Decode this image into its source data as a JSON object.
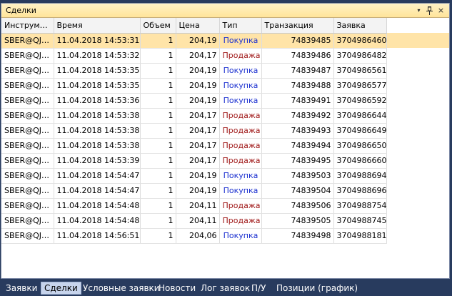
{
  "window": {
    "title": "Сделки",
    "dropdown_icon": "▾",
    "pin_icon": "pushpin-icon",
    "close_icon": "×"
  },
  "columns": [
    "Инструм…",
    "Время",
    "Объем",
    "Цена",
    "Тип",
    "Транзакция",
    "Заявка"
  ],
  "rows": [
    {
      "instrument": "SBER@QJ…",
      "time": "11.04.2018 14:53:31",
      "volume": "1",
      "price": "204,19",
      "type": "Покупка",
      "side": "buy",
      "transaction": "74839485",
      "order": "3704986460"
    },
    {
      "instrument": "SBER@QJ…",
      "time": "11.04.2018 14:53:32",
      "volume": "1",
      "price": "204,17",
      "type": "Продажа",
      "side": "sell",
      "transaction": "74839486",
      "order": "3704986482"
    },
    {
      "instrument": "SBER@QJ…",
      "time": "11.04.2018 14:53:35",
      "volume": "1",
      "price": "204,19",
      "type": "Покупка",
      "side": "buy",
      "transaction": "74839487",
      "order": "3704986561"
    },
    {
      "instrument": "SBER@QJ…",
      "time": "11.04.2018 14:53:35",
      "volume": "1",
      "price": "204,19",
      "type": "Покупка",
      "side": "buy",
      "transaction": "74839488",
      "order": "3704986577"
    },
    {
      "instrument": "SBER@QJ…",
      "time": "11.04.2018 14:53:36",
      "volume": "1",
      "price": "204,19",
      "type": "Покупка",
      "side": "buy",
      "transaction": "74839491",
      "order": "3704986592"
    },
    {
      "instrument": "SBER@QJ…",
      "time": "11.04.2018 14:53:38",
      "volume": "1",
      "price": "204,17",
      "type": "Продажа",
      "side": "sell",
      "transaction": "74839492",
      "order": "3704986644"
    },
    {
      "instrument": "SBER@QJ…",
      "time": "11.04.2018 14:53:38",
      "volume": "1",
      "price": "204,17",
      "type": "Продажа",
      "side": "sell",
      "transaction": "74839493",
      "order": "3704986649"
    },
    {
      "instrument": "SBER@QJ…",
      "time": "11.04.2018 14:53:38",
      "volume": "1",
      "price": "204,17",
      "type": "Продажа",
      "side": "sell",
      "transaction": "74839494",
      "order": "3704986650"
    },
    {
      "instrument": "SBER@QJ…",
      "time": "11.04.2018 14:53:39",
      "volume": "1",
      "price": "204,17",
      "type": "Продажа",
      "side": "sell",
      "transaction": "74839495",
      "order": "3704986660"
    },
    {
      "instrument": "SBER@QJ…",
      "time": "11.04.2018 14:54:47",
      "volume": "1",
      "price": "204,19",
      "type": "Покупка",
      "side": "buy",
      "transaction": "74839503",
      "order": "3704988694"
    },
    {
      "instrument": "SBER@QJ…",
      "time": "11.04.2018 14:54:47",
      "volume": "1",
      "price": "204,19",
      "type": "Покупка",
      "side": "buy",
      "transaction": "74839504",
      "order": "3704988696"
    },
    {
      "instrument": "SBER@QJ…",
      "time": "11.04.2018 14:54:48",
      "volume": "1",
      "price": "204,11",
      "type": "Продажа",
      "side": "sell",
      "transaction": "74839506",
      "order": "3704988754"
    },
    {
      "instrument": "SBER@QJ…",
      "time": "11.04.2018 14:54:48",
      "volume": "1",
      "price": "204,11",
      "type": "Продажа",
      "side": "sell",
      "transaction": "74839505",
      "order": "3704988745"
    },
    {
      "instrument": "SBER@QJ…",
      "time": "11.04.2018 14:56:51",
      "volume": "1",
      "price": "204,06",
      "type": "Покупка",
      "side": "buy",
      "transaction": "74839498",
      "order": "3704988181"
    }
  ],
  "tabs": [
    {
      "label": "Заявки",
      "active": false
    },
    {
      "label": "Сделки",
      "active": true
    },
    {
      "label": "Условные заявки",
      "active": false
    },
    {
      "label": "Новости",
      "active": false
    },
    {
      "label": "Лог заявок",
      "active": false
    },
    {
      "label": "П/У",
      "active": false
    },
    {
      "label": "Позиции (график)",
      "active": false
    }
  ],
  "colors": {
    "buy": "#1a2fd0",
    "sell": "#a01818",
    "selected_row": "#ffe4a8",
    "background": "#283b5e"
  }
}
